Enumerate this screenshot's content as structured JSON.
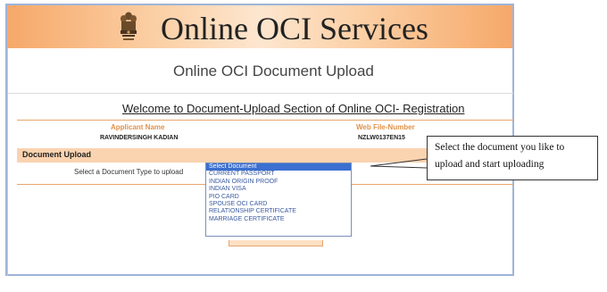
{
  "banner": {
    "title": "Online OCI Services",
    "emblem": "india-emblem-icon"
  },
  "page": {
    "subtitle": "Online OCI Document Upload",
    "welcome": "Welcome to Document-Upload Section of Online OCI- Registration"
  },
  "applicant": {
    "name_label": "Applicant Name",
    "name_value": "RAVINDERSINGH KADIAN",
    "file_label": "Web File-Number",
    "file_value": "NZLW0137EN15"
  },
  "upload": {
    "section_title": "Document Upload",
    "type_label": "Select a Document Type to upload",
    "options": [
      "Select Document",
      "CURRENT PASSPORT",
      "INDIAN ORIGIN PROOF",
      "INDIAN VISA",
      "PIO CARD",
      "SPOUSE OCI CARD",
      "RELATIONSHIP CERTIFICATE",
      "MARRIAGE CERTIFICATE"
    ],
    "selected_option": "Select Document"
  },
  "callout": {
    "line1": "Select the document  you like to",
    "line2": "upload and start uploading"
  },
  "colors": {
    "accent": "#f6a869",
    "header_label": "#e0914a",
    "select_highlight": "#3b6fd0"
  }
}
